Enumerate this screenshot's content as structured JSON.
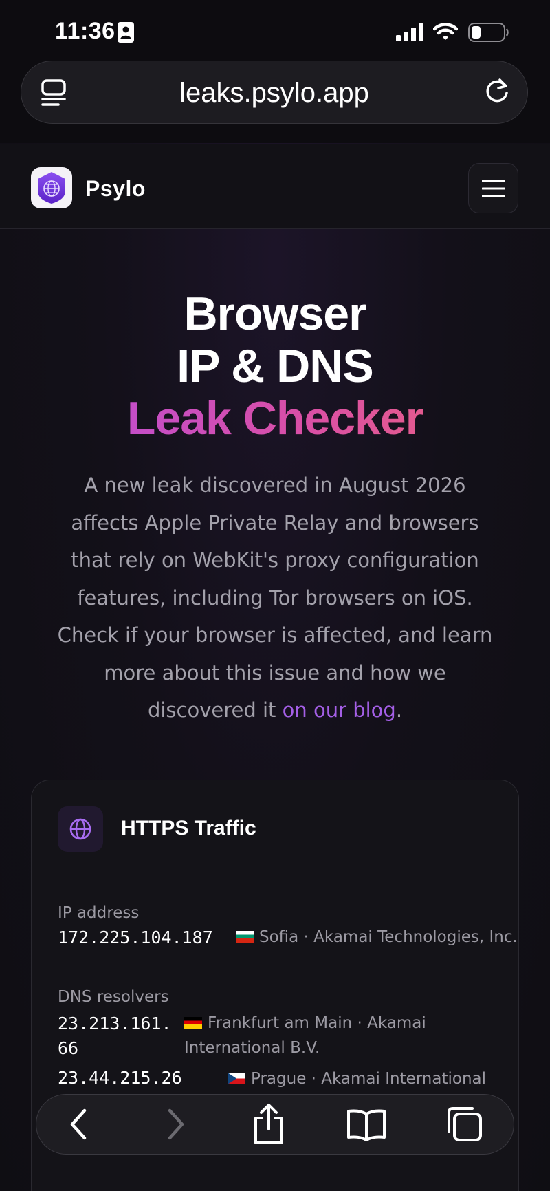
{
  "status_bar": {
    "time": "11:36",
    "icons": [
      "contact-card-icon",
      "cellular-signal-icon",
      "wifi-icon",
      "battery-icon"
    ]
  },
  "browser": {
    "url": "leaks.psylo.app",
    "icons": [
      "reader-icon",
      "reload-icon"
    ]
  },
  "site_header": {
    "brand": "Psylo",
    "icons": [
      "psylo-shield-logo-icon",
      "hamburger-menu-icon"
    ]
  },
  "hero": {
    "title_line1": "Browser",
    "title_line2": "IP & DNS",
    "title_line3": "Leak Checker",
    "description": "A new leak discovered in August 2026 affects Apple Private Relay and browsers that rely on WebKit's proxy configuration features, including Tor browsers on iOS. Check if your browser is affected, and learn more about this issue and how we discovered it ",
    "link_text": "on our blog",
    "period": ".",
    "colors": {
      "gradient_start": "#b54de0",
      "gradient_end": "#ee6678",
      "link": "#a45fe6"
    }
  },
  "card": {
    "title": "HTTPS Traffic",
    "icon": "globe-icon",
    "ip_label": "IP address",
    "ip_value": "172.225.104.187",
    "ip_location": "Sofia · Akamai Technologies, Inc.",
    "ip_flag": "bulgaria-flag-icon",
    "dns_label": "DNS resolvers",
    "dns": [
      {
        "ip_line1": "23.213.161.",
        "ip_line2": "66",
        "location_line1": "Frankfurt am Main · Akamai",
        "location_line2": "International B.V.",
        "flag": "germany-flag-icon"
      },
      {
        "ip_line1": "23.44.215.26",
        "location_line1": "Prague · Akamai International B.V.",
        "flag": "czechia-flag-icon"
      }
    ]
  },
  "toolbar": {
    "icons": [
      "back-icon",
      "forward-icon",
      "share-icon",
      "bookmarks-icon",
      "tabs-icon"
    ]
  }
}
